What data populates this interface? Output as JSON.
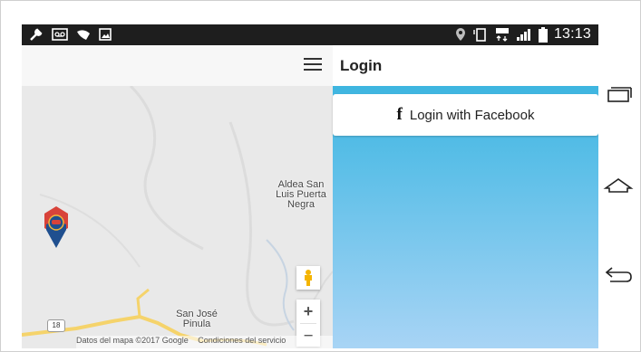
{
  "status_bar": {
    "time": "13:13",
    "left_icons": [
      "wrench-icon",
      "voicemail-icon",
      "tag-icon",
      "image-icon"
    ],
    "right_icons": [
      "location-icon",
      "vibrate-icon",
      "data-4g-icon",
      "signal-icon",
      "battery-icon"
    ]
  },
  "map": {
    "labels": {
      "aldea": "Aldea San Luis Puerta Negra",
      "aldea_line1": "Aldea San",
      "aldea_line2": "Luis Puerta",
      "aldea_line3": "Negra",
      "sanjose_line1": "San José",
      "sanjose_line2": "Pinula"
    },
    "route_number": "18",
    "copyright": "Datos del mapa ©2017 Google",
    "terms": "Condiciones del servicio",
    "zoom_in": "+",
    "zoom_out": "−"
  },
  "panel": {
    "title": "Login",
    "facebook_button": "Login with Facebook",
    "facebook_glyph": "f"
  },
  "colors": {
    "panel_top": "#2fb1dc",
    "panel_bottom": "#a8d4f5",
    "road": "#f5d36b",
    "marker_red": "#d8433a",
    "marker_blue": "#1f4f8f"
  }
}
